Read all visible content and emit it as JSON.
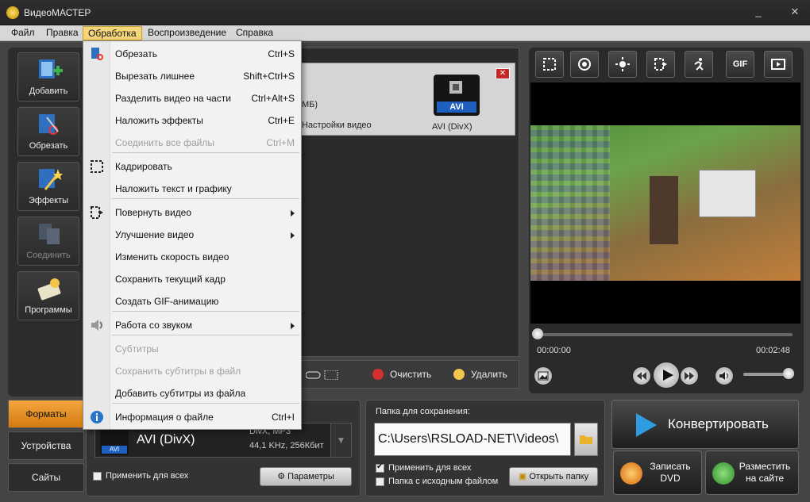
{
  "window": {
    "title": "ВидеоМАСТЕР",
    "minimize": "_",
    "close": "✕"
  },
  "menubar": [
    "Файл",
    "Правка",
    "Обработка",
    "Воспроизведение",
    "Справка"
  ],
  "sidebar": [
    {
      "label": "Добавить",
      "icon": "add-video-icon"
    },
    {
      "label": "Обрезать",
      "icon": "cut-icon"
    },
    {
      "label": "Эффекты",
      "icon": "effects-icon"
    },
    {
      "label": "Соединить",
      "icon": "join-icon"
    },
    {
      "label": "Программы",
      "icon": "programs-icon"
    }
  ],
  "file_item": {
    "size_fragment": "МБ)",
    "settings": "Настройки видео",
    "format_badge": "AVI",
    "format_name": "AVI (DivX)"
  },
  "list_toolbar": {
    "clear": "Очистить",
    "delete": "Удалить"
  },
  "preview": {
    "tools": [
      "crop-icon",
      "watermark-icon",
      "brightness-icon",
      "rotate-icon",
      "speed-icon",
      "GIF",
      "snapshot-icon"
    ],
    "gif_label": "GIF",
    "time_start": "00:00:00",
    "time_end": "00:02:48"
  },
  "bottom_tabs": [
    "Форматы",
    "Устройства",
    "Сайты"
  ],
  "format": {
    "badge": "AVI",
    "name": "AVI (DivX)",
    "desc1": "DivX, MP3",
    "desc2": "44,1 KHz, 256Кбит",
    "apply_all": "Применить для всех",
    "params": "Параметры"
  },
  "folder": {
    "title": "Папка для сохранения:",
    "path": "C:\\Users\\RSLOAD-NET\\Videos\\",
    "apply_all": "Применить для всех",
    "source_folder": "Папка с исходным файлом",
    "open_folder": "Открыть папку"
  },
  "actions": {
    "convert": "Конвертировать",
    "burn_dvd": "Записать DVD",
    "publish": "Разместить на сайте"
  },
  "dropdown": {
    "items": [
      {
        "label": "Обрезать",
        "shortcut": "Ctrl+S",
        "icon": "cut-icon",
        "enabled": true
      },
      {
        "label": "Вырезать лишнее",
        "shortcut": "Shift+Ctrl+S",
        "enabled": true
      },
      {
        "label": "Разделить видео на части",
        "shortcut": "Ctrl+Alt+S",
        "enabled": true
      },
      {
        "label": "Наложить эффекты",
        "shortcut": "Ctrl+E",
        "enabled": true
      },
      {
        "label": "Соединить все файлы",
        "shortcut": "Ctrl+M",
        "enabled": false
      },
      {
        "label": "Кадрировать",
        "shortcut": "",
        "icon": "crop-icon",
        "enabled": true
      },
      {
        "label": "Наложить текст и графику",
        "shortcut": "",
        "enabled": true
      },
      {
        "label": "Повернуть видео",
        "shortcut": "",
        "icon": "rotate-icon",
        "submenu": true,
        "enabled": true
      },
      {
        "label": "Улучшение видео",
        "shortcut": "",
        "submenu": true,
        "enabled": true
      },
      {
        "label": "Изменить скорость видео",
        "shortcut": "",
        "enabled": true
      },
      {
        "label": "Сохранить текущий кадр",
        "shortcut": "",
        "enabled": true
      },
      {
        "label": "Создать GIF-анимацию",
        "shortcut": "",
        "enabled": true
      },
      {
        "label": "Работа со звуком",
        "shortcut": "",
        "icon": "sound-icon",
        "submenu": true,
        "enabled": true
      },
      {
        "label": "Субтитры",
        "shortcut": "",
        "enabled": false
      },
      {
        "label": "Сохранить субтитры в файл",
        "shortcut": "",
        "enabled": false
      },
      {
        "label": "Добавить субтитры из файла",
        "shortcut": "",
        "enabled": true
      },
      {
        "label": "Информация о файле",
        "shortcut": "Ctrl+I",
        "icon": "info-icon",
        "enabled": true
      }
    ]
  }
}
